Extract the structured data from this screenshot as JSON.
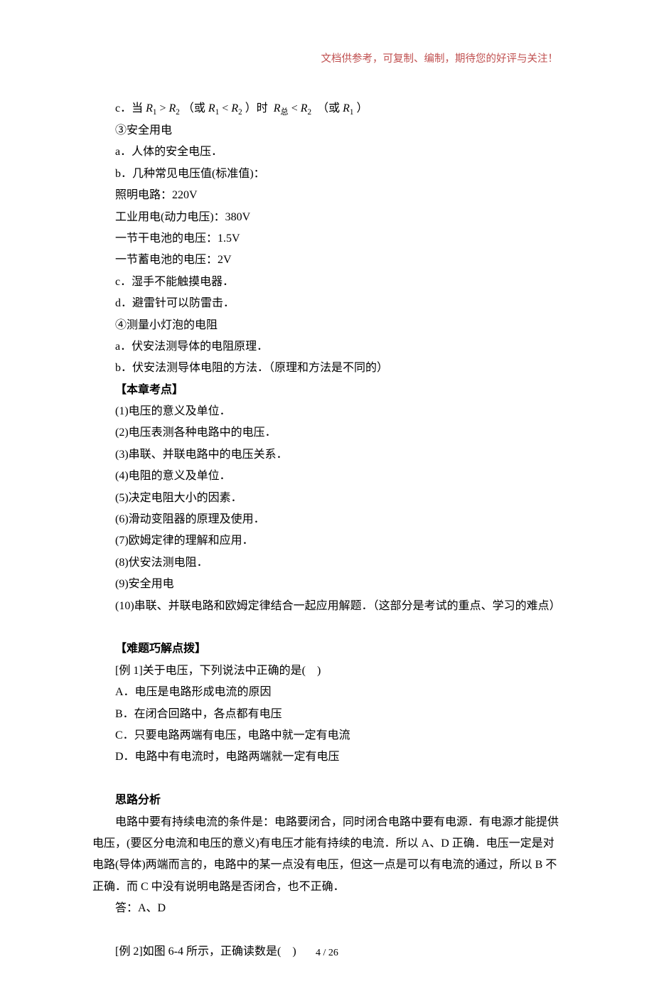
{
  "header_note": "文档供参考，可复制、编制，期待您的好评与关注！",
  "eq_line": {
    "prefix": "c．当",
    "r1gtr2": "R₁ > R₂",
    "or1": "（或",
    "r1ltr2": "R₁ < R₂",
    "close1": "）时",
    "rtot": "R总 < R₂",
    "or2": "（或",
    "r1": "R₁",
    "close2": "）"
  },
  "lines": {
    "s3": "③安全用电",
    "s3a": "a．人体的安全电压．",
    "s3b": "b．几种常见电压值(标准值)：",
    "light": "照明电路：220V",
    "ind": "工业用电(动力电压)：380V",
    "dry": "一节干电池的电压：1.5V",
    "storage": "一节蓄电池的电压：2V",
    "s3c": "c．湿手不能触摸电器．",
    "s3d": "d．避雷针可以防雷击．",
    "s4": "④测量小灯泡的电阻",
    "s4a": "a．伏安法测导体的电阻原理．",
    "s4b": "b．伏安法测导体电阻的方法．（原理和方法是不同的）",
    "kdTitle": "【本章考点】",
    "k1": "(1)电压的意义及单位．",
    "k2": "(2)电压表测各种电路中的电压．",
    "k3": "(3)串联、并联电路中的电压关系．",
    "k4": "(4)电阻的意义及单位．",
    "k5": "(5)决定电阻大小的因素．",
    "k6": "(6)滑动变阻器的原理及使用．",
    "k7": "(7)欧姆定律的理解和应用．",
    "k8": "(8)伏安法测电阻．",
    "k9": "(9)安全用电",
    "k10": "(10)串联、并联电路和欧姆定律结合一起应用解题．（这部分是考试的重点、学习的难点）",
    "hardTitle": "【难题巧解点拨】",
    "ex1": "[例 1]关于电压，下列说法中正确的是(　)",
    "ex1a": "A．电压是电路形成电流的原因",
    "ex1b": "B．在闭合回路中，各点都有电压",
    "ex1c": "C．只要电路两端有电压，电路中就一定有电流",
    "ex1d": "D．电路中有电流时，电路两端就一定有电压",
    "thinkTitle": "思路分析",
    "thinkBody": "电路中要有持续电流的条件是：电路要闭合，同时闭合电路中要有电源．有电源才能提供电压，(要区分电流和电压的意义)有电压才能有持续的电流．所以 A、D 正确．电压一定是对电路(导体)两端而言的，电路中的某一点没有电压，但这一点是可以有电流的通过，所以 B 不正确．而 C 中没有说明电路是否闭合，也不正确．",
    "answer": "答：A、D",
    "ex2": "[例 2]如图 6-4 所示，正确读数是(　)"
  },
  "footer": "4 / 26"
}
